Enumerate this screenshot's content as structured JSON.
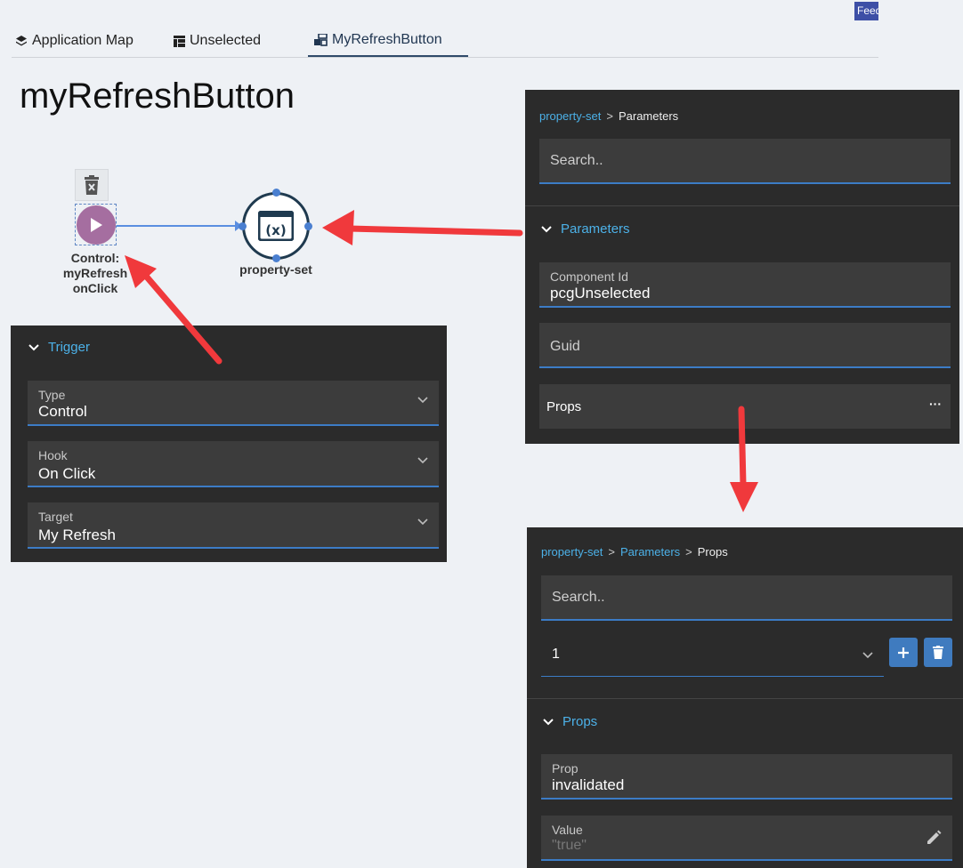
{
  "feedback_label": "Feed",
  "tabs": [
    {
      "label": "Application Map"
    },
    {
      "label": "Unselected"
    },
    {
      "label": "MyRefreshButton"
    }
  ],
  "page_title": "myRefreshButton",
  "canvas": {
    "control_node_label": "Control:\nmyRefresh\nonClick",
    "property_set_label": "property-set",
    "property_set_glyph": "(x)"
  },
  "trigger_panel": {
    "section": "Trigger",
    "fields": [
      {
        "label": "Type",
        "value": "Control"
      },
      {
        "label": "Hook",
        "value": "On Click"
      },
      {
        "label": "Target",
        "value": "My Refresh"
      }
    ]
  },
  "parameters_panel": {
    "breadcrumb": [
      "property-set",
      "Parameters"
    ],
    "search_placeholder": "Search..",
    "section": "Parameters",
    "component_id": {
      "label": "Component Id",
      "value": "pcgUnselected"
    },
    "guid": {
      "placeholder": "Guid"
    },
    "props": {
      "label": "Props",
      "more": "···"
    }
  },
  "props_panel": {
    "breadcrumb": [
      "property-set",
      "Parameters",
      "Props"
    ],
    "search_placeholder": "Search..",
    "selector_value": "1",
    "section": "Props",
    "prop": {
      "label": "Prop",
      "value": "invalidated"
    },
    "value": {
      "label": "Value",
      "placeholder": "\"true\""
    }
  },
  "colors": {
    "accent_link": "#4cb1e8",
    "panel_bg": "#2b2b2b",
    "field_bg": "#3c3c3c",
    "field_underline": "#3c7cc6",
    "annotation_arrow": "#f0393c",
    "control_node": "#a56ea0"
  }
}
